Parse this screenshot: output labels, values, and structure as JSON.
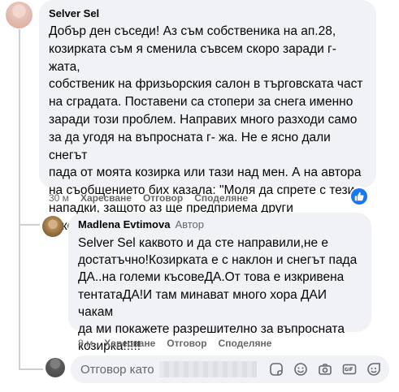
{
  "comment": {
    "author": "Selver Sel",
    "text": "Добър ден съседи! Аз съм собственика на ап.28,\nкозирката съм я сменила съвсем скоро заради г- жата,\nсобственик на фризьорския салон в търговската част\nна сградата. Поставени са стопери за снега именно\nзаради този проблем. Направих много разходи само\nза да угодя на въпросната г- жа. Не е ясно дали снегът\nпада от моята козирка или тази над мен. А на автора\nна съобщението бих казала: \"Моля да спрете с тези\nнападки, защото аз ще предприема други\nзаконосъобразни действия!!!!!\". Хубав и спокоен ден!",
    "time": "30 м",
    "like_label": "Харесване",
    "reply_label": "Отговор",
    "share_label": "Споделяне",
    "like_icon": "thumbs-up-icon",
    "accent_color": "#1877f2"
  },
  "reply": {
    "author": "Madlena Evtimova",
    "author_tag": "Автор",
    "text": "Selver Sel каквото и да сте направили,не е\nдостатъчно!Козирката е с наклон и снегът пада\nДА..на големи късовеДА.От това е изкривена\nтентатаДА!И там минават много хора ДАИ чакам\nда ми покажете разрешително за въпросната\nкозирка!!!!!",
    "time": "8 м",
    "like_label": "Харесване",
    "reply_label": "Отговор",
    "share_label": "Споделяне"
  },
  "reply_box": {
    "placeholder": "Отговор като",
    "icons": [
      "sticker-icon",
      "emoji-icon",
      "camera-icon",
      "gif-icon",
      "sticker-smile-icon"
    ]
  }
}
